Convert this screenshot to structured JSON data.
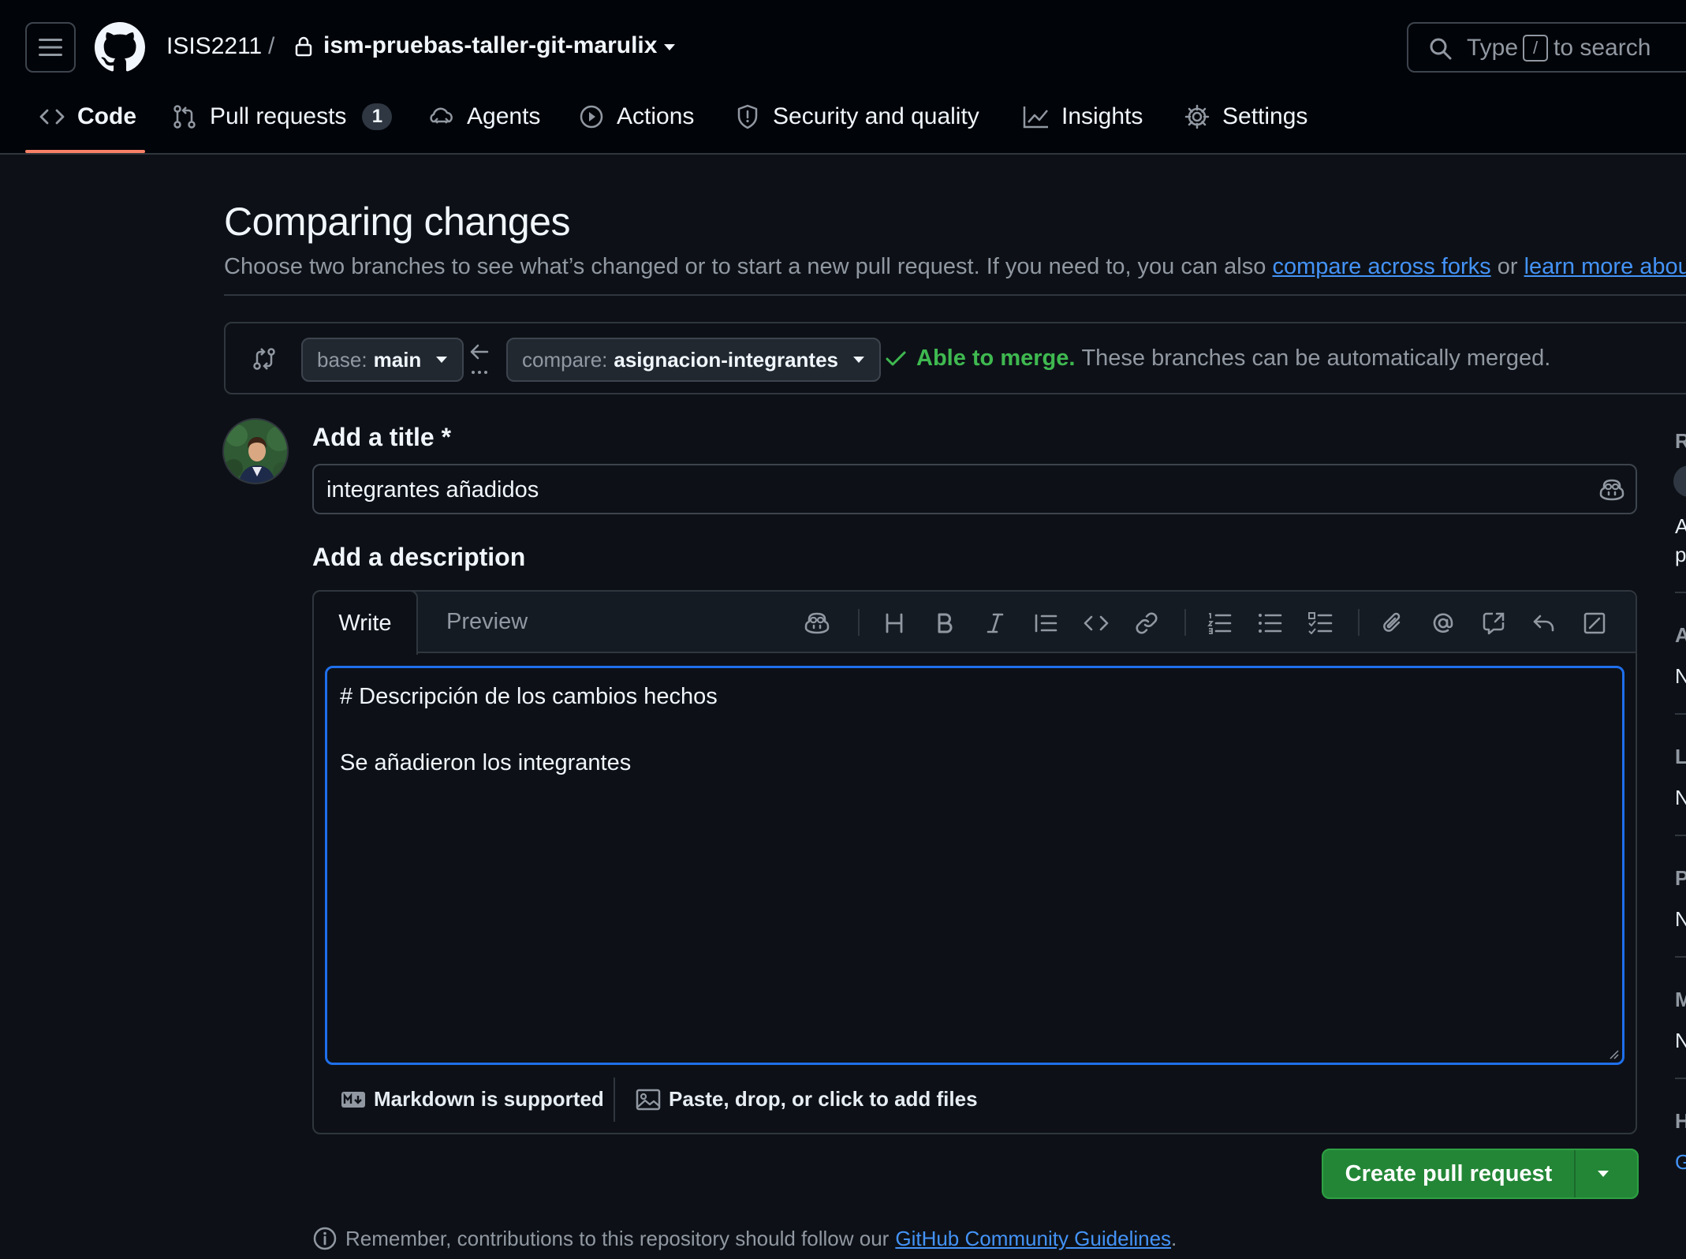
{
  "header": {
    "owner": "ISIS2211",
    "separator": "/",
    "repo": "ism-pruebas-taller-git-marulix",
    "search": {
      "prefix": "Type",
      "key": "/",
      "suffix": "to search"
    }
  },
  "nav": [
    {
      "label": "Code",
      "icon": "code-icon"
    },
    {
      "label": "Pull requests",
      "icon": "git-pull-request-icon",
      "count": "1"
    },
    {
      "label": "Agents",
      "icon": "agents-icon"
    },
    {
      "label": "Actions",
      "icon": "play-icon"
    },
    {
      "label": "Security and quality",
      "icon": "shield-icon"
    },
    {
      "label": "Insights",
      "icon": "graph-icon"
    },
    {
      "label": "Settings",
      "icon": "gear-icon"
    }
  ],
  "main": {
    "title": "Comparing changes",
    "subtitle_pre": "Choose two branches to see what’s changed or to start a new pull request. If you need to, you can also",
    "link_forks": "compare across forks",
    "subtitle_or": "or",
    "link_learn": "learn more abou"
  },
  "range": {
    "base_label": "base:",
    "base_value": "main",
    "compare_label": "compare:",
    "compare_value": "asignacion-integrantes",
    "merge_status": "Able to merge.",
    "merge_detail": "These branches can be automatically merged."
  },
  "form": {
    "title_label": "Add a title",
    "required_mark": "*",
    "title_value": "integrantes añadidos",
    "desc_label": "Add a description",
    "tab_write": "Write",
    "tab_preview": "Preview",
    "body_lines": [
      "# Descripción de los cambios hechos",
      "",
      "Se añadieron los integrantes"
    ],
    "markdown_note": "Markdown is supported",
    "files_note": "Paste, drop, or click to add files",
    "submit": "Create pull request"
  },
  "footer": {
    "remember": "Remember, contributions to this repository should follow our",
    "guidelines_link": "GitHub Community Guidelines",
    "period": "."
  },
  "sidebar_fragments": [
    "R",
    "A",
    "p",
    "A",
    "N",
    "L",
    "N",
    "P",
    "N",
    "M",
    "N",
    "H",
    "G"
  ],
  "colors": {
    "bg": "#0d1117",
    "header_bg": "#010409",
    "accent_underline": "#f78166",
    "link": "#4493f8",
    "success": "#3fb950",
    "primary_button": "#238636",
    "focus_border": "#1f6feb"
  }
}
